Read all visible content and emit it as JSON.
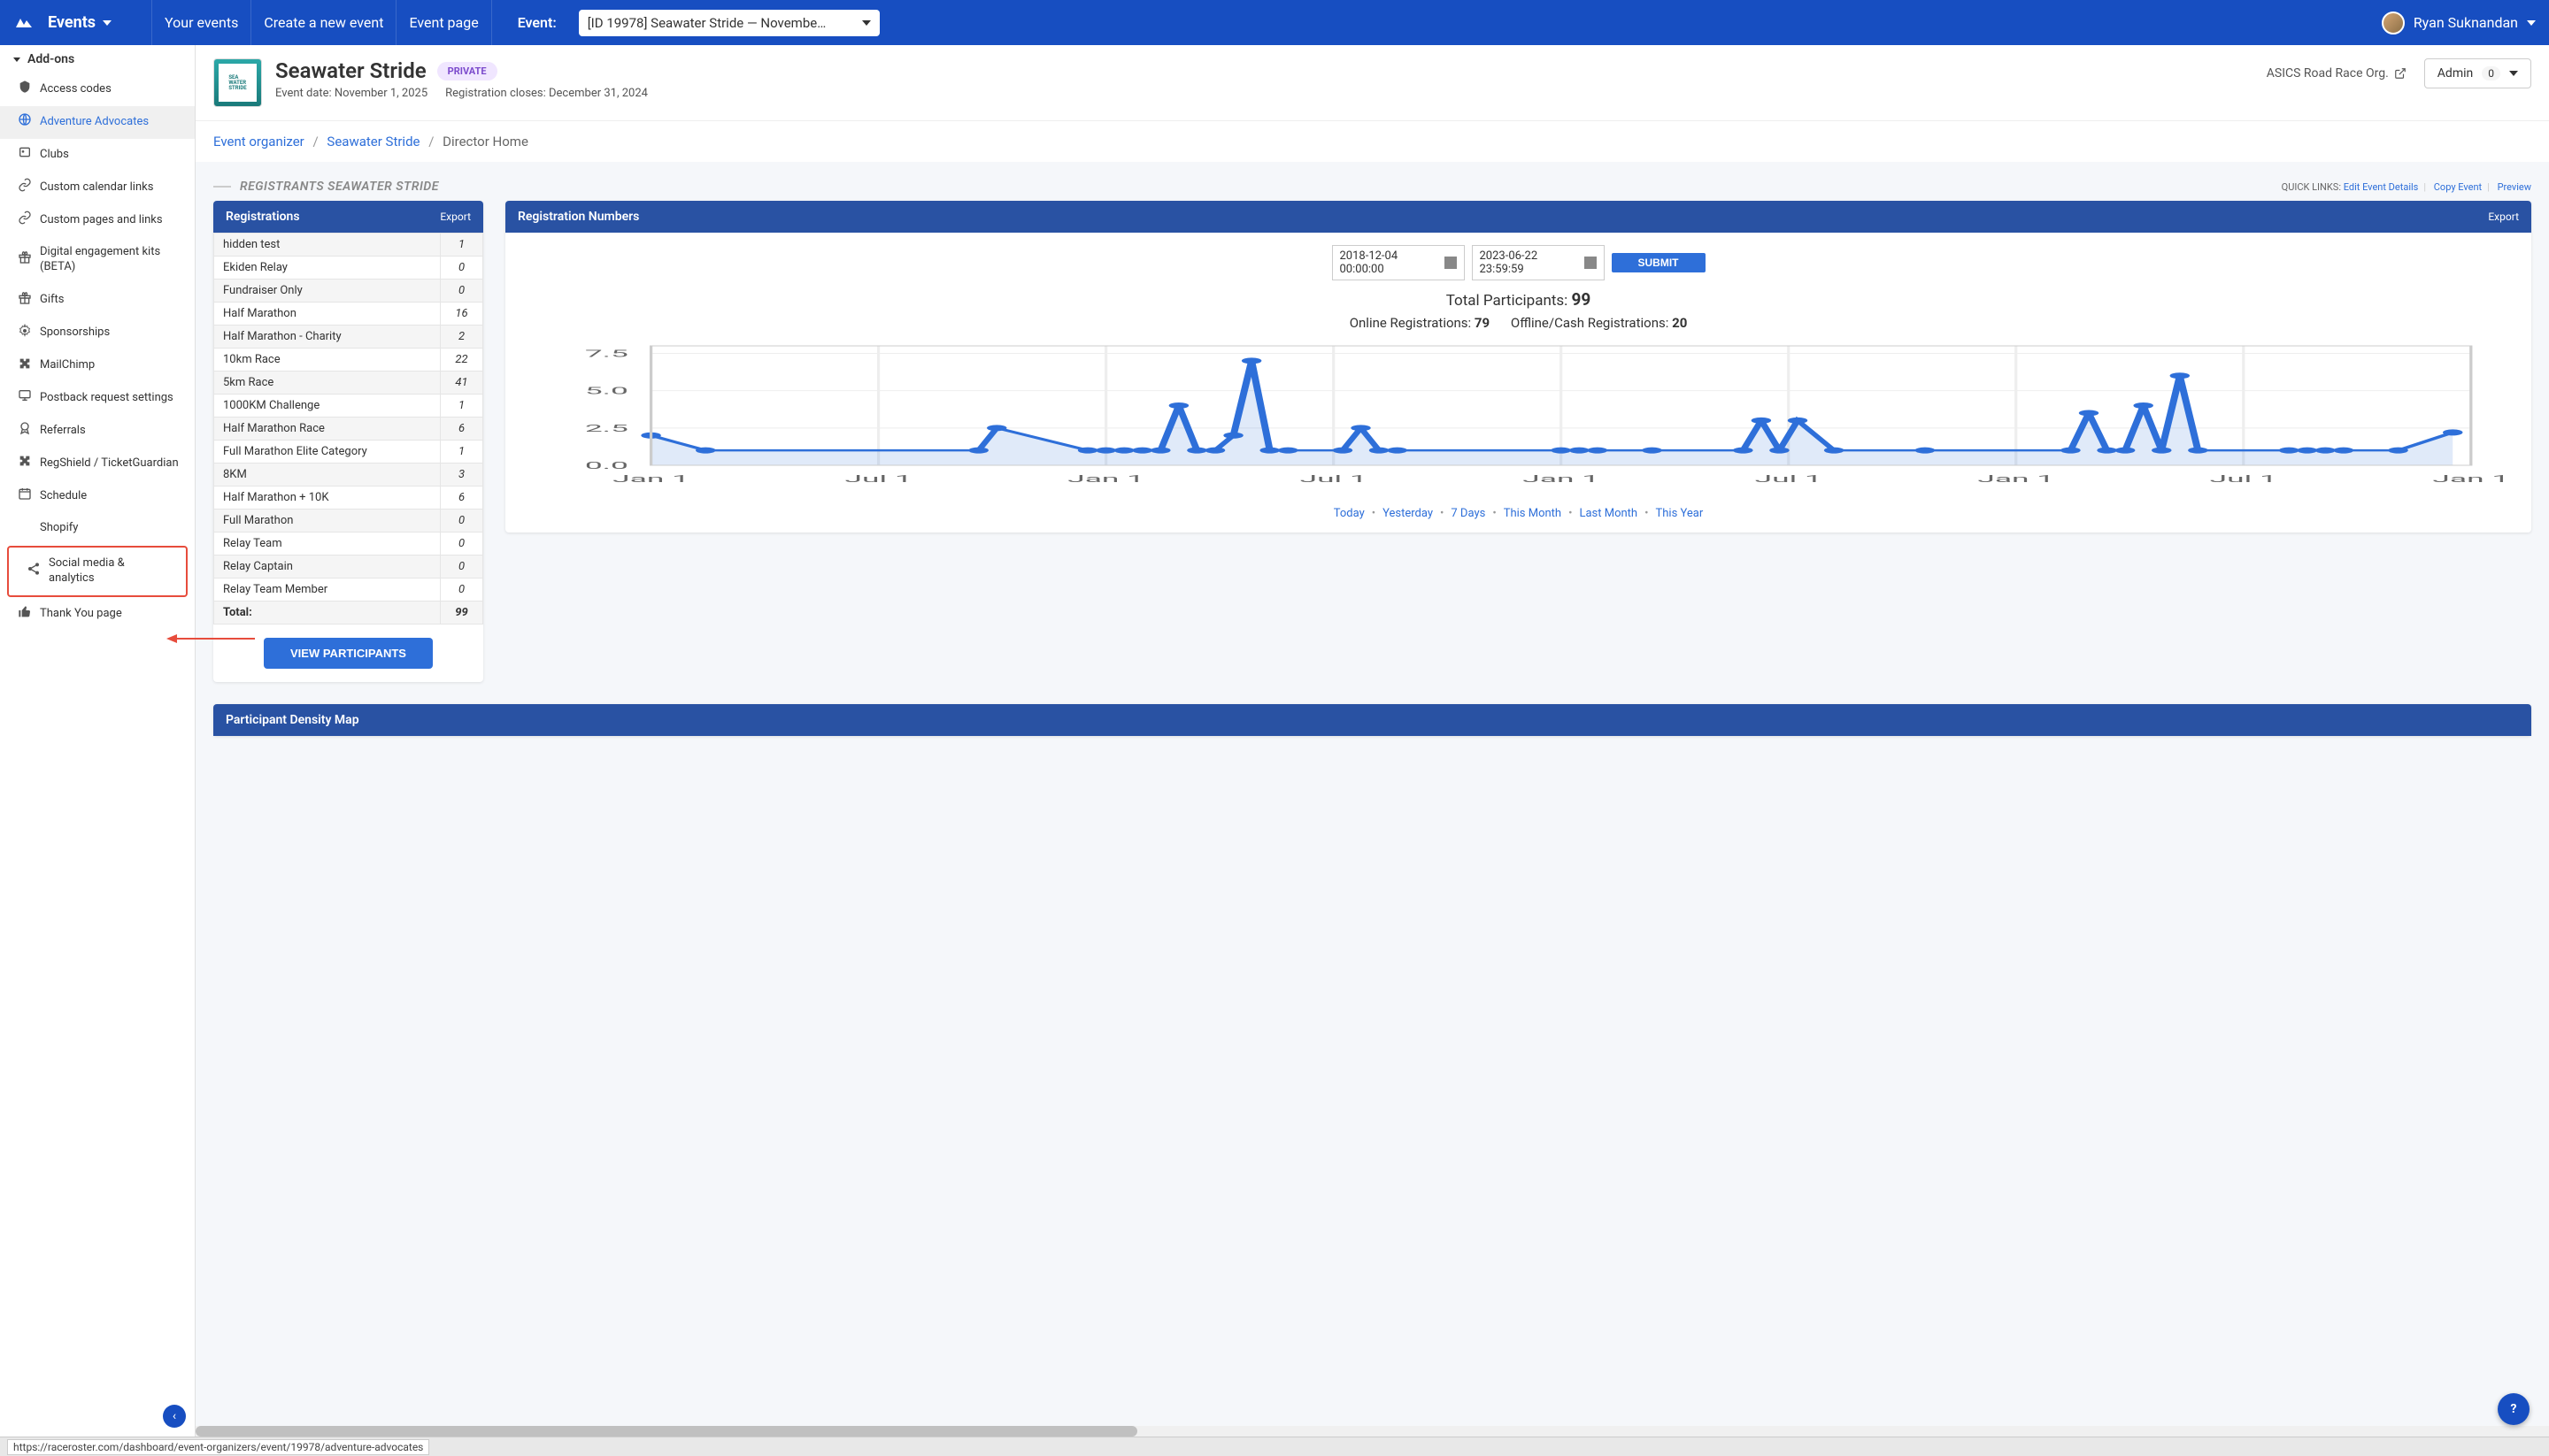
{
  "topbar": {
    "events_label": "Events",
    "nav": [
      "Your events",
      "Create a new event",
      "Event page"
    ],
    "event_label": "Event:",
    "event_select": "[ID 19978] Seawater Stride — Novembe…",
    "user_name": "Ryan Suknandan"
  },
  "sidebar": {
    "header": "Add-ons",
    "items": [
      {
        "icon": "shield",
        "label": "Access codes"
      },
      {
        "icon": "globe",
        "label": "Adventure Advocates",
        "active": true
      },
      {
        "icon": "id",
        "label": "Clubs"
      },
      {
        "icon": "link",
        "label": "Custom calendar links"
      },
      {
        "icon": "link",
        "label": "Custom pages and links"
      },
      {
        "icon": "gift",
        "label": "Digital engagement kits (BETA)"
      },
      {
        "icon": "gift",
        "label": "Gifts"
      },
      {
        "icon": "gear",
        "label": "Sponsorships"
      },
      {
        "icon": "puzzle",
        "label": "MailChimp"
      },
      {
        "icon": "monitor",
        "label": "Postback request settings"
      },
      {
        "icon": "badge",
        "label": "Referrals"
      },
      {
        "icon": "puzzle",
        "label": "RegShield / TicketGuardian"
      },
      {
        "icon": "calendar",
        "label": "Schedule"
      },
      {
        "icon": "",
        "label": "Shopify"
      },
      {
        "icon": "share",
        "label": "Social media & analytics",
        "highlight": true
      },
      {
        "icon": "thumb",
        "label": "Thank You page"
      }
    ]
  },
  "event_header": {
    "title": "Seawater Stride",
    "badge": "PRIVATE",
    "date_label": "Event date: November 1, 2025",
    "reg_close": "Registration closes: December 31, 2024",
    "org": "ASICS Road Race Org.",
    "admin_label": "Admin",
    "admin_count": "0"
  },
  "breadcrumb": {
    "a": "Event organizer",
    "b": "Seawater Stride",
    "c": "Director Home"
  },
  "section": {
    "title": "REGISTRANTS SEAWATER STRIDE",
    "quick_links_label": "QUICK LINKS:",
    "links": [
      "Edit Event Details",
      "Copy Event",
      "Preview"
    ]
  },
  "registrations": {
    "header": "Registrations",
    "export": "Export",
    "rows": [
      {
        "name": "hidden test",
        "count": "1"
      },
      {
        "name": "Ekiden Relay",
        "count": "0"
      },
      {
        "name": "Fundraiser Only",
        "count": "0"
      },
      {
        "name": "Half Marathon",
        "count": "16"
      },
      {
        "name": "Half Marathon - Charity",
        "count": "2"
      },
      {
        "name": "10km Race",
        "count": "22"
      },
      {
        "name": "5km Race",
        "count": "41"
      },
      {
        "name": "1000KM Challenge",
        "count": "1"
      },
      {
        "name": "Half Marathon Race",
        "count": "6"
      },
      {
        "name": "Full Marathon Elite Category",
        "count": "1"
      },
      {
        "name": "8KM",
        "count": "3"
      },
      {
        "name": "Half Marathon + 10K",
        "count": "6"
      },
      {
        "name": "Full Marathon",
        "count": "0"
      },
      {
        "name": "Relay Team",
        "count": "0"
      },
      {
        "name": "Relay Captain",
        "count": "0"
      },
      {
        "name": "Relay Team Member",
        "count": "0"
      },
      {
        "name": "Total:",
        "count": "99"
      }
    ],
    "view_btn": "VIEW PARTICIPANTS"
  },
  "numbers_panel": {
    "header": "Registration Numbers",
    "export": "Export",
    "date_from": "2018-12-04 00:00:00",
    "date_to": "2023-06-22 23:59:59",
    "submit": "SUBMIT",
    "total_label": "Total Participants:",
    "total_val": "99",
    "online_label": "Online Registrations:",
    "online_val": "79",
    "offline_label": "Offline/Cash Registrations:",
    "offline_val": "20",
    "ranges": [
      "Today",
      "Yesterday",
      "7 Days",
      "This Month",
      "Last Month",
      "This Year"
    ]
  },
  "chart_data": {
    "type": "area",
    "y_ticks": [
      0.0,
      2.5,
      5.0,
      7.5
    ],
    "x_labels": [
      "Jan 1",
      "Jul 1",
      "Jan 1",
      "Jul 1",
      "Jan 1",
      "Jul 1",
      "Jan 1",
      "Jul 1",
      "Jan 1"
    ],
    "series": [
      {
        "name": "Registrations",
        "points": [
          {
            "x": 0,
            "y": 2.0
          },
          {
            "x": 3,
            "y": 1.0
          },
          {
            "x": 18,
            "y": 1.0
          },
          {
            "x": 19,
            "y": 2.5
          },
          {
            "x": 24,
            "y": 1.0
          },
          {
            "x": 25,
            "y": 1.0
          },
          {
            "x": 26,
            "y": 1.0
          },
          {
            "x": 27,
            "y": 1.0
          },
          {
            "x": 28,
            "y": 1.0
          },
          {
            "x": 29,
            "y": 4.0
          },
          {
            "x": 30,
            "y": 1.0
          },
          {
            "x": 31,
            "y": 1.0
          },
          {
            "x": 32,
            "y": 2.0
          },
          {
            "x": 33,
            "y": 7.0
          },
          {
            "x": 34,
            "y": 1.0
          },
          {
            "x": 35,
            "y": 1.0
          },
          {
            "x": 38,
            "y": 1.0
          },
          {
            "x": 39,
            "y": 2.5
          },
          {
            "x": 40,
            "y": 1.0
          },
          {
            "x": 41,
            "y": 1.0
          },
          {
            "x": 50,
            "y": 1.0
          },
          {
            "x": 51,
            "y": 1.0
          },
          {
            "x": 52,
            "y": 1.0
          },
          {
            "x": 55,
            "y": 1.0
          },
          {
            "x": 60,
            "y": 1.0
          },
          {
            "x": 61,
            "y": 3.0
          },
          {
            "x": 62,
            "y": 1.0
          },
          {
            "x": 63,
            "y": 3.0
          },
          {
            "x": 65,
            "y": 1.0
          },
          {
            "x": 70,
            "y": 1.0
          },
          {
            "x": 78,
            "y": 1.0
          },
          {
            "x": 79,
            "y": 3.5
          },
          {
            "x": 80,
            "y": 1.0
          },
          {
            "x": 81,
            "y": 1.0
          },
          {
            "x": 82,
            "y": 4.0
          },
          {
            "x": 83,
            "y": 1.0
          },
          {
            "x": 84,
            "y": 6.0
          },
          {
            "x": 85,
            "y": 1.0
          },
          {
            "x": 90,
            "y": 1.0
          },
          {
            "x": 91,
            "y": 1.0
          },
          {
            "x": 92,
            "y": 1.0
          },
          {
            "x": 93,
            "y": 1.0
          },
          {
            "x": 96,
            "y": 1.0
          },
          {
            "x": 99,
            "y": 2.2
          }
        ]
      }
    ]
  },
  "map_panel": {
    "header": "Participant Density Map"
  },
  "status_url": "https://raceroster.com/dashboard/event-organizers/event/19978/adventure-advocates"
}
